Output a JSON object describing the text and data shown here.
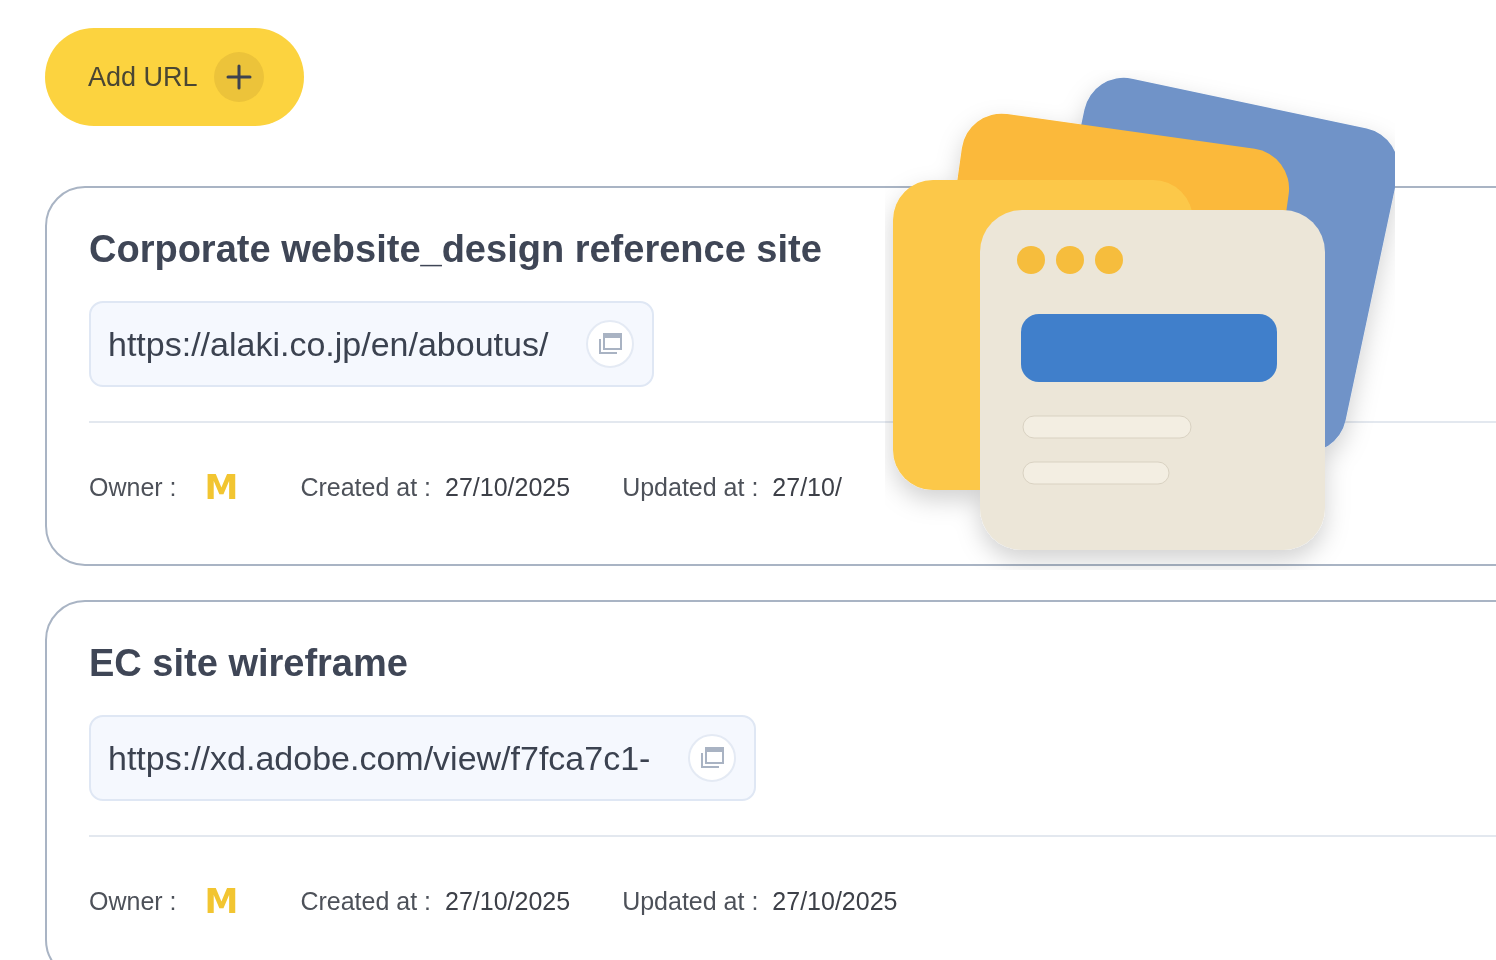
{
  "add_button": {
    "label": "Add URL"
  },
  "cards": [
    {
      "title": "Corporate website_design reference site",
      "url": "https://alaki.co.jp/en/aboutus/",
      "owner_label": "Owner :",
      "owner": "M",
      "created_label": "Created at :",
      "created": "27/10/2025",
      "updated_label": "Updated at :",
      "updated": "27/10/"
    },
    {
      "title": "EC site wireframe",
      "url": "https://xd.adobe.com/view/f7fca7c1-",
      "owner_label": "Owner :",
      "owner": "M",
      "created_label": "Created at :",
      "created": "27/10/2025",
      "updated_label": "Updated at :",
      "updated": "27/10/2025"
    }
  ]
}
